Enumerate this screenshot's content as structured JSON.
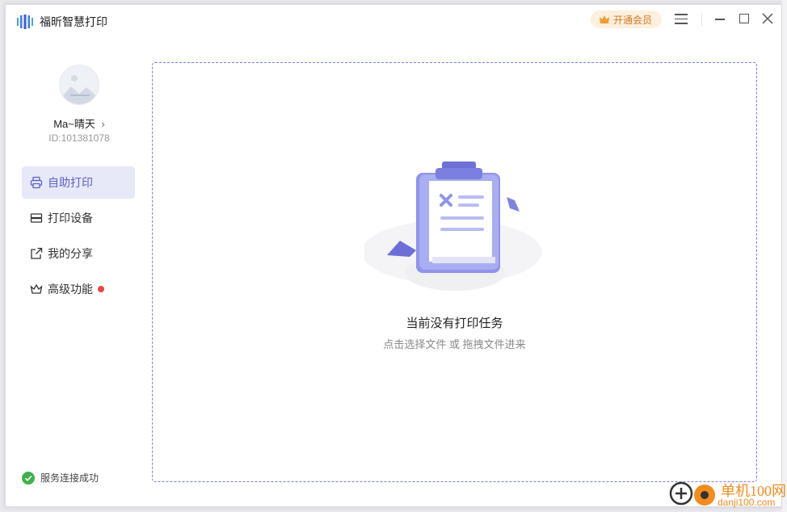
{
  "app": {
    "title": "福昕智慧打印"
  },
  "titlebar": {
    "vip_label": "开通会员"
  },
  "user": {
    "name": "Ma~晴天",
    "chevron": "›",
    "id": "ID:101381078"
  },
  "sidebar": {
    "items": [
      {
        "label": "自助打印",
        "icon": "printer-icon",
        "active": true
      },
      {
        "label": "打印设备",
        "icon": "device-icon",
        "active": false
      },
      {
        "label": "我的分享",
        "icon": "share-icon",
        "active": false
      },
      {
        "label": "高级功能",
        "icon": "crown-icon",
        "active": false,
        "badge": "red-dot"
      }
    ],
    "status": "服务连接成功"
  },
  "main": {
    "empty_title": "当前没有打印任务",
    "empty_hint": "点击选择文件 或 拖拽文件进来"
  },
  "watermark": {
    "brand": "单机100网",
    "url": "danji100.com"
  },
  "colors": {
    "accent": "#5b5fc7",
    "vip": "#d2781c",
    "success": "#3cb34a",
    "badge": "#e84545"
  }
}
